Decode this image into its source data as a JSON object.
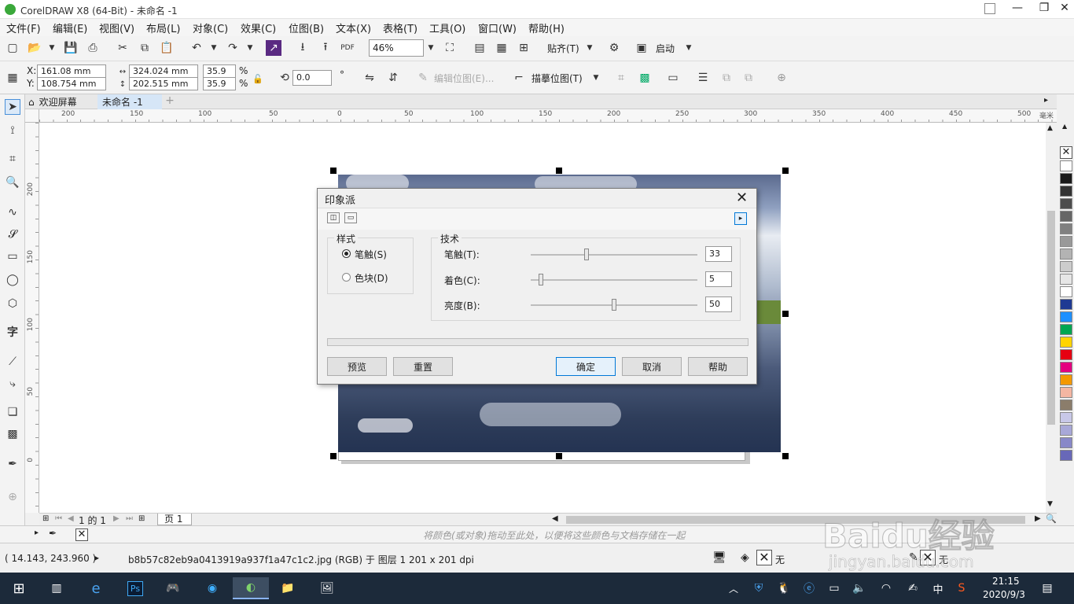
{
  "window": {
    "title": "CorelDRAW X8 (64-Bit) - 未命名 -1"
  },
  "menu": [
    "文件(F)",
    "编辑(E)",
    "视图(V)",
    "布局(L)",
    "对象(C)",
    "效果(C)",
    "位图(B)",
    "文本(X)",
    "表格(T)",
    "工具(O)",
    "窗口(W)",
    "帮助(H)"
  ],
  "toolbar": {
    "zoom": "46%",
    "snap_label": "贴齐(T)",
    "launch_label": "启动"
  },
  "props": {
    "x": "161.08 mm",
    "y": "108.754 mm",
    "w": "324.024 mm",
    "h": "202.515 mm",
    "sx": "35.9",
    "sy": "35.9",
    "pct": "%",
    "angle": "0.0",
    "deg": "°",
    "edit_bitmap": "编辑位图(E)...",
    "trace_bitmap": "描摹位图(T)"
  },
  "tabs": {
    "welcome": "欢迎屏幕",
    "doc": "未命名 -1"
  },
  "ruler_h": [
    "200",
    "150",
    "100",
    "50",
    "0",
    "50",
    "100",
    "150",
    "200",
    "250",
    "300",
    "350",
    "400",
    "450",
    "500",
    "毫米"
  ],
  "ruler_v": [
    "200",
    "150",
    "100",
    "50",
    "0"
  ],
  "dialog": {
    "title": "印象派",
    "style_group": "样式",
    "style_stroke": "笔触(S)",
    "style_block": "色块(D)",
    "tech_group": "技术",
    "sliders": [
      {
        "label": "笔触(T):",
        "value": "33",
        "level": 0.33
      },
      {
        "label": "着色(C):",
        "value": "5",
        "level": 0.05
      },
      {
        "label": "亮度(B):",
        "value": "50",
        "level": 0.5
      }
    ],
    "btn_preview": "预览",
    "btn_reset": "重置",
    "btn_ok": "确定",
    "btn_cancel": "取消",
    "btn_help": "帮助"
  },
  "pagebar": {
    "page_info": "1 的 1",
    "page_tab": "页 1"
  },
  "colorbar": {
    "hint": "将颜色(或对象)拖动至此处，以便将这些颜色与文档存储在一起"
  },
  "status": {
    "coords": "( 14.143, 243.960 )",
    "arrow": "▸",
    "info": "b8b57c82eb9a0413919a937f1a47c1c2.jpg (RGB) 于 图层 1 201 x 201 dpi",
    "fill_none": "无",
    "outline_none": "无"
  },
  "taskbar": {
    "time": "21:15",
    "date": "2020/9/3",
    "ime": "中"
  },
  "palette": [
    "#ffffff",
    "#1a1a1a",
    "#333333",
    "#4d4d4d",
    "#666666",
    "#808080",
    "#999999",
    "#b3b3b3",
    "#cccccc",
    "#e6e6e6",
    "#ffffff",
    "#1f3a93",
    "#1e90ff",
    "#00a651",
    "#ffd400",
    "#e60012",
    "#e4007f",
    "#f39800",
    "#f4b6a2",
    "#8b7d6b",
    "#c8c8e8",
    "#a8a8d8",
    "#8888c8",
    "#6868b8"
  ],
  "watermark": {
    "brand": "Baidu经验",
    "url": "jingyan.baidu.com"
  }
}
